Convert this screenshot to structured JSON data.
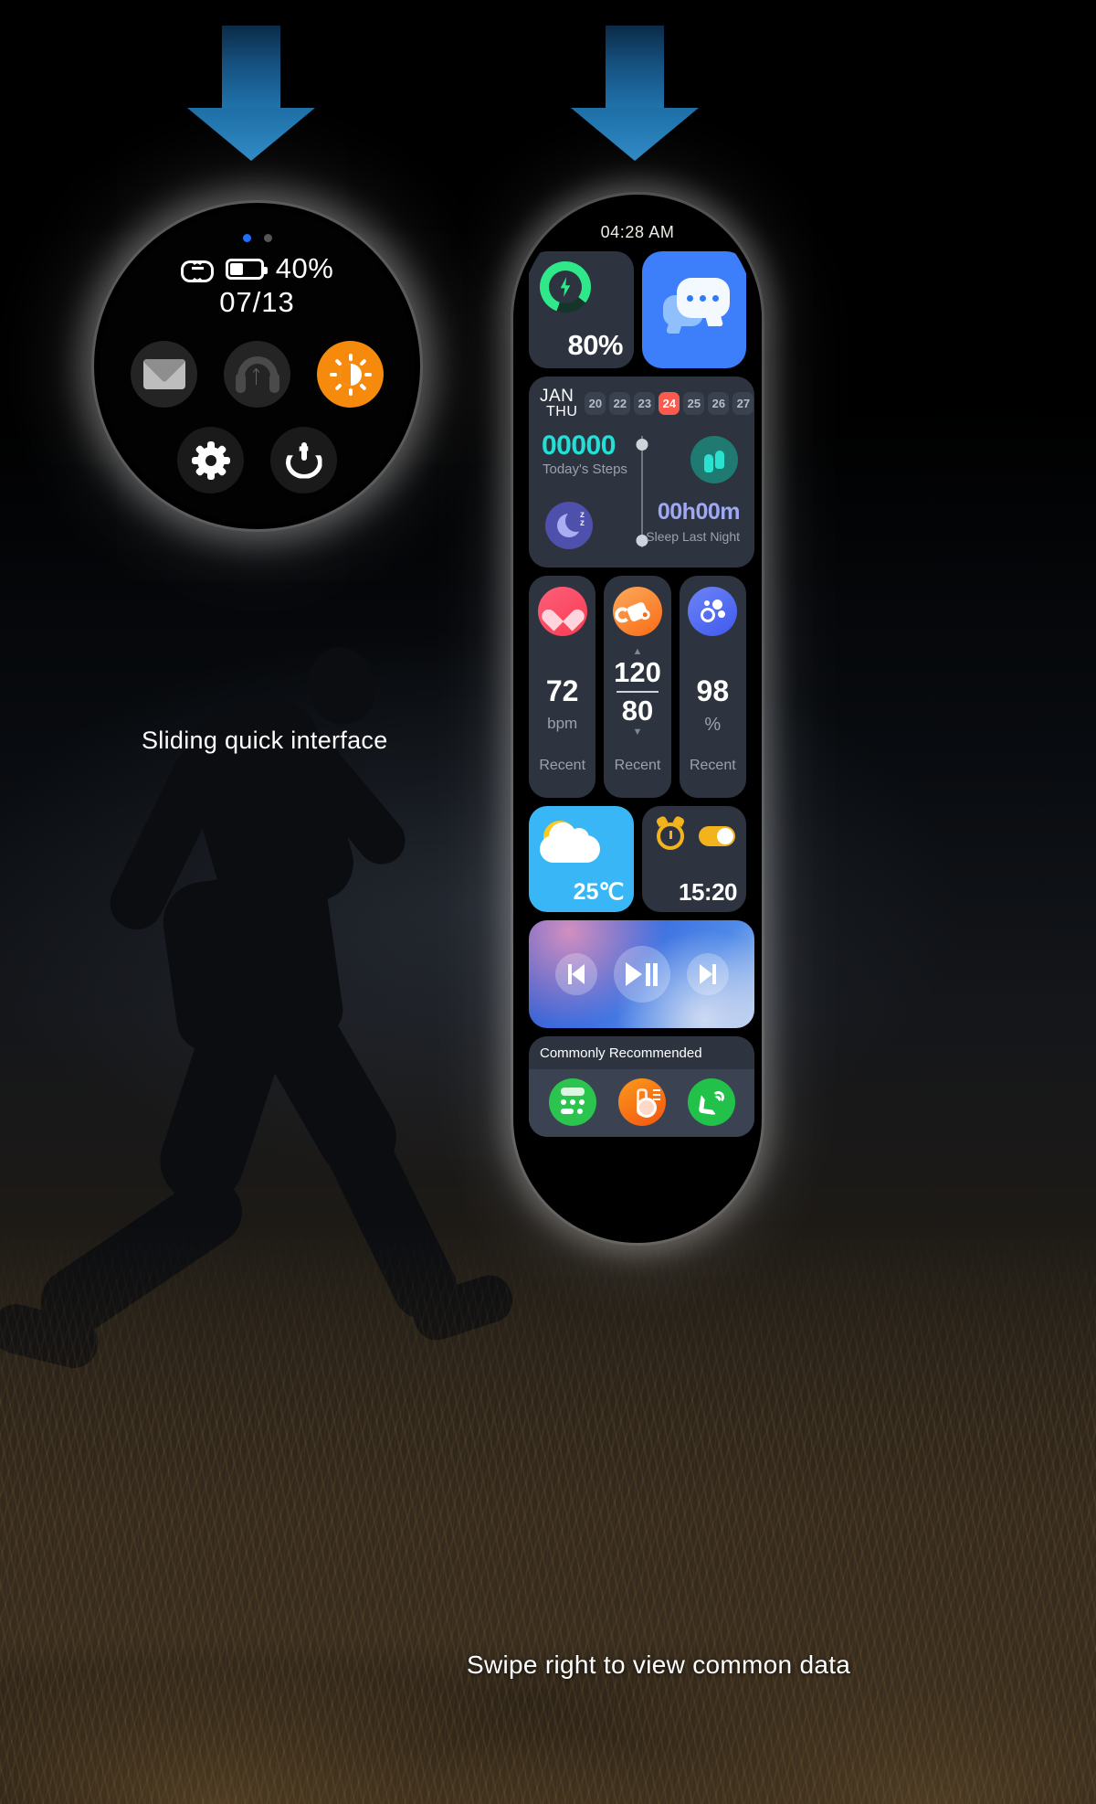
{
  "captions": {
    "left": "Sliding quick interface",
    "bottom": "Swipe right to view common data"
  },
  "round_watch": {
    "battery_percent": "40%",
    "date": "07/13",
    "quick_buttons": [
      {
        "name": "mail",
        "label": "Mail"
      },
      {
        "name": "bluetooth-headphones",
        "label": "Bluetooth Audio"
      },
      {
        "name": "brightness",
        "label": "Brightness"
      },
      {
        "name": "settings",
        "label": "Settings"
      },
      {
        "name": "power",
        "label": "Power"
      }
    ],
    "page_indicator": {
      "total": 2,
      "active": 1
    }
  },
  "rect_watch": {
    "time": "04:28 AM",
    "battery": {
      "percent": "80%"
    },
    "messages": {
      "label": "Messages"
    },
    "calendar": {
      "month": "JAN",
      "weekday": "THU",
      "days": [
        "20",
        "22",
        "23",
        "24",
        "25",
        "26",
        "27"
      ],
      "today": "24"
    },
    "activity": {
      "steps_value": "00000",
      "steps_label": "Today's Steps",
      "sleep_value": "00h00m",
      "sleep_label": "Sleep Last Night"
    },
    "vitals": [
      {
        "icon": "heart",
        "value": "72",
        "unit": "bpm",
        "status": "Recent"
      },
      {
        "icon": "blood-pressure",
        "systolic": "120",
        "diastolic": "80",
        "status": "Recent"
      },
      {
        "icon": "blood-oxygen",
        "value": "98",
        "unit": "%",
        "status": "Recent"
      }
    ],
    "weather": {
      "temperature": "25℃"
    },
    "alarm": {
      "time": "15:20",
      "enabled": true
    },
    "music": {
      "prev": "Previous",
      "playpause": "Play/Pause",
      "next": "Next"
    },
    "recommended": {
      "title": "Commonly Recommended",
      "apps": [
        {
          "name": "calculator"
        },
        {
          "name": "thermometer"
        },
        {
          "name": "phone"
        }
      ]
    }
  },
  "colors": {
    "accent_orange": "#f58a0c",
    "battery_green": "#2ee88a",
    "today_red": "#fb5b4f",
    "steps_cyan": "#22e0d6",
    "sleep_purple": "#9fa8f5",
    "message_blue": "#3d7ffb",
    "weather_blue": "#39b6f5",
    "alarm_yellow": "#f2b31c"
  }
}
